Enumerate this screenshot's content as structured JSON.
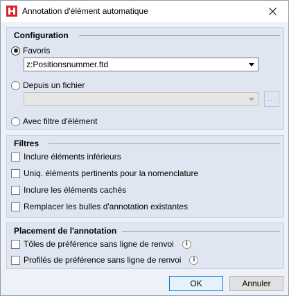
{
  "window": {
    "title": "Annotation d'élément automatique",
    "app_icon": "app-logo-icon",
    "close_icon": "close-icon"
  },
  "configuration": {
    "title": "Configuration",
    "favoris_label": "Favoris",
    "favoris_value": "z:Positionsnummer.ftd",
    "file_label": "Depuis un fichier",
    "file_value": "",
    "browse_label": "...",
    "filter_label": "Avec filtre d'élément",
    "selected": "favoris"
  },
  "filters": {
    "title": "Filtres",
    "items": [
      {
        "label": "Inclure éléments inférieurs",
        "checked": false
      },
      {
        "label": "Uniq. éléments pertinents pour la nomenclature",
        "checked": false
      },
      {
        "label": "Inclure les éléments cachés",
        "checked": false
      },
      {
        "label": "Remplacer les bulles d'annotation existantes",
        "checked": false
      }
    ]
  },
  "placement": {
    "title": "Placement de l'annotation",
    "items": [
      {
        "label": "Tôles de préférence sans ligne de renvoi",
        "checked": false,
        "info_icon": "info-icon"
      },
      {
        "label": "Profilés de préférence sans ligne de renvoi",
        "checked": false,
        "info_icon": "info-icon"
      }
    ]
  },
  "buttons": {
    "ok": "OK",
    "cancel": "Annuler"
  },
  "colors": {
    "dialog_bg": "#eef1f7",
    "group_bg": "#dfe6f1",
    "focus_border": "#0078d7",
    "app_icon_red": "#d9232e"
  }
}
